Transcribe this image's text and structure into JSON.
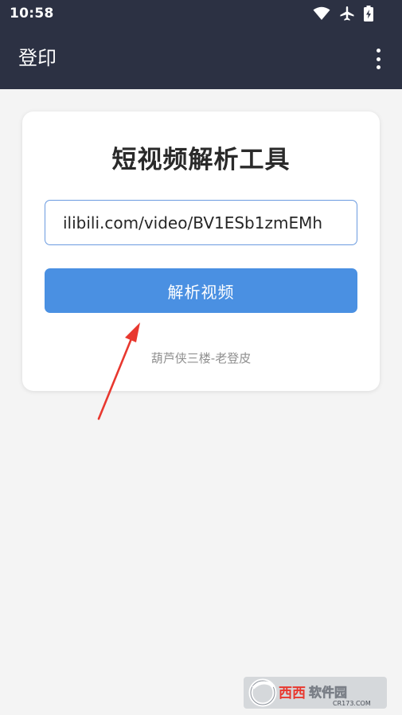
{
  "status_bar": {
    "time": "10:58",
    "icons": [
      "wifi-icon",
      "airplane-icon",
      "battery-charging-icon"
    ]
  },
  "app_bar": {
    "title": "登印",
    "menu_icon": "more-vert-icon"
  },
  "card": {
    "title": "短视频解析工具",
    "url_input": {
      "value": "ilibili.com/video/BV1ESb1zmEMh",
      "placeholder": ""
    },
    "parse_button_label": "解析视频",
    "credit": "葫芦侠三楼-老登皮"
  },
  "annotation": {
    "type": "arrow",
    "color": "#e8382f",
    "points_to": "parse-button"
  },
  "watermark": {
    "text_main": "西西软件园",
    "text_sub": "CR173.COM"
  },
  "colors": {
    "bar_background": "#2c3143",
    "page_background": "#f4f4f4",
    "accent": "#4a90e2",
    "input_border": "#6b9be0"
  }
}
